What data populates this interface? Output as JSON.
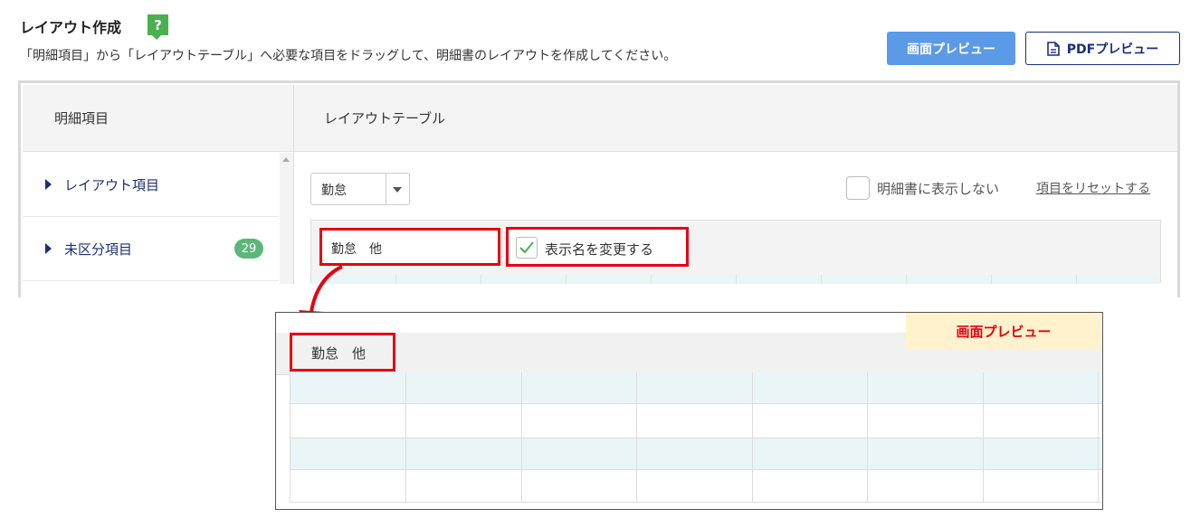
{
  "header": {
    "title": "レイアウト作成",
    "help_glyph": "?",
    "description": "「明細項目」から「レイアウトテーブル」へ必要な項目をドラッグして、明細書のレイアウトを作成してください。",
    "screen_preview_button": "画面プレビュー",
    "pdf_preview_button": "PDFプレビュー"
  },
  "left_panel": {
    "heading": "明細項目",
    "items": [
      {
        "label": "レイアウト項目"
      },
      {
        "label": "未区分項目",
        "count": "29"
      }
    ]
  },
  "right_panel": {
    "heading": "レイアウトテーブル",
    "category_select": "勤怠",
    "hide_in_statement_label": "明細書に表示しない",
    "reset_link": "項目をリセットする",
    "table_name_value": "勤怠　他",
    "rename_label": "表示名を変更する",
    "rename_checked": true
  },
  "preview": {
    "tag": "画面プレビュー",
    "table_name": "勤怠　他"
  },
  "colors": {
    "highlight": "#e60012",
    "primary_button": "#5b9ae6",
    "navy": "#1a2f7a",
    "badge_green": "#5db67a",
    "row_tint": "#eaf5f7",
    "tag_bg": "#fff2cc"
  }
}
